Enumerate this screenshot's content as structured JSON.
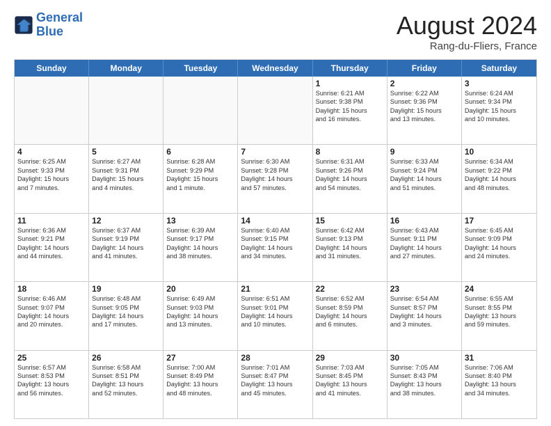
{
  "logo": {
    "text_general": "General",
    "text_blue": "Blue"
  },
  "header": {
    "month_year": "August 2024",
    "location": "Rang-du-Fliers, France"
  },
  "weekdays": [
    "Sunday",
    "Monday",
    "Tuesday",
    "Wednesday",
    "Thursday",
    "Friday",
    "Saturday"
  ],
  "weeks": [
    [
      {
        "day": "",
        "lines": [],
        "empty": true
      },
      {
        "day": "",
        "lines": [],
        "empty": true
      },
      {
        "day": "",
        "lines": [],
        "empty": true
      },
      {
        "day": "",
        "lines": [],
        "empty": true
      },
      {
        "day": "1",
        "lines": [
          "Sunrise: 6:21 AM",
          "Sunset: 9:38 PM",
          "Daylight: 15 hours",
          "and 16 minutes."
        ],
        "empty": false
      },
      {
        "day": "2",
        "lines": [
          "Sunrise: 6:22 AM",
          "Sunset: 9:36 PM",
          "Daylight: 15 hours",
          "and 13 minutes."
        ],
        "empty": false
      },
      {
        "day": "3",
        "lines": [
          "Sunrise: 6:24 AM",
          "Sunset: 9:34 PM",
          "Daylight: 15 hours",
          "and 10 minutes."
        ],
        "empty": false
      }
    ],
    [
      {
        "day": "4",
        "lines": [
          "Sunrise: 6:25 AM",
          "Sunset: 9:33 PM",
          "Daylight: 15 hours",
          "and 7 minutes."
        ],
        "empty": false
      },
      {
        "day": "5",
        "lines": [
          "Sunrise: 6:27 AM",
          "Sunset: 9:31 PM",
          "Daylight: 15 hours",
          "and 4 minutes."
        ],
        "empty": false
      },
      {
        "day": "6",
        "lines": [
          "Sunrise: 6:28 AM",
          "Sunset: 9:29 PM",
          "Daylight: 15 hours",
          "and 1 minute."
        ],
        "empty": false
      },
      {
        "day": "7",
        "lines": [
          "Sunrise: 6:30 AM",
          "Sunset: 9:28 PM",
          "Daylight: 14 hours",
          "and 57 minutes."
        ],
        "empty": false
      },
      {
        "day": "8",
        "lines": [
          "Sunrise: 6:31 AM",
          "Sunset: 9:26 PM",
          "Daylight: 14 hours",
          "and 54 minutes."
        ],
        "empty": false
      },
      {
        "day": "9",
        "lines": [
          "Sunrise: 6:33 AM",
          "Sunset: 9:24 PM",
          "Daylight: 14 hours",
          "and 51 minutes."
        ],
        "empty": false
      },
      {
        "day": "10",
        "lines": [
          "Sunrise: 6:34 AM",
          "Sunset: 9:22 PM",
          "Daylight: 14 hours",
          "and 48 minutes."
        ],
        "empty": false
      }
    ],
    [
      {
        "day": "11",
        "lines": [
          "Sunrise: 6:36 AM",
          "Sunset: 9:21 PM",
          "Daylight: 14 hours",
          "and 44 minutes."
        ],
        "empty": false
      },
      {
        "day": "12",
        "lines": [
          "Sunrise: 6:37 AM",
          "Sunset: 9:19 PM",
          "Daylight: 14 hours",
          "and 41 minutes."
        ],
        "empty": false
      },
      {
        "day": "13",
        "lines": [
          "Sunrise: 6:39 AM",
          "Sunset: 9:17 PM",
          "Daylight: 14 hours",
          "and 38 minutes."
        ],
        "empty": false
      },
      {
        "day": "14",
        "lines": [
          "Sunrise: 6:40 AM",
          "Sunset: 9:15 PM",
          "Daylight: 14 hours",
          "and 34 minutes."
        ],
        "empty": false
      },
      {
        "day": "15",
        "lines": [
          "Sunrise: 6:42 AM",
          "Sunset: 9:13 PM",
          "Daylight: 14 hours",
          "and 31 minutes."
        ],
        "empty": false
      },
      {
        "day": "16",
        "lines": [
          "Sunrise: 6:43 AM",
          "Sunset: 9:11 PM",
          "Daylight: 14 hours",
          "and 27 minutes."
        ],
        "empty": false
      },
      {
        "day": "17",
        "lines": [
          "Sunrise: 6:45 AM",
          "Sunset: 9:09 PM",
          "Daylight: 14 hours",
          "and 24 minutes."
        ],
        "empty": false
      }
    ],
    [
      {
        "day": "18",
        "lines": [
          "Sunrise: 6:46 AM",
          "Sunset: 9:07 PM",
          "Daylight: 14 hours",
          "and 20 minutes."
        ],
        "empty": false
      },
      {
        "day": "19",
        "lines": [
          "Sunrise: 6:48 AM",
          "Sunset: 9:05 PM",
          "Daylight: 14 hours",
          "and 17 minutes."
        ],
        "empty": false
      },
      {
        "day": "20",
        "lines": [
          "Sunrise: 6:49 AM",
          "Sunset: 9:03 PM",
          "Daylight: 14 hours",
          "and 13 minutes."
        ],
        "empty": false
      },
      {
        "day": "21",
        "lines": [
          "Sunrise: 6:51 AM",
          "Sunset: 9:01 PM",
          "Daylight: 14 hours",
          "and 10 minutes."
        ],
        "empty": false
      },
      {
        "day": "22",
        "lines": [
          "Sunrise: 6:52 AM",
          "Sunset: 8:59 PM",
          "Daylight: 14 hours",
          "and 6 minutes."
        ],
        "empty": false
      },
      {
        "day": "23",
        "lines": [
          "Sunrise: 6:54 AM",
          "Sunset: 8:57 PM",
          "Daylight: 14 hours",
          "and 3 minutes."
        ],
        "empty": false
      },
      {
        "day": "24",
        "lines": [
          "Sunrise: 6:55 AM",
          "Sunset: 8:55 PM",
          "Daylight: 13 hours",
          "and 59 minutes."
        ],
        "empty": false
      }
    ],
    [
      {
        "day": "25",
        "lines": [
          "Sunrise: 6:57 AM",
          "Sunset: 8:53 PM",
          "Daylight: 13 hours",
          "and 56 minutes."
        ],
        "empty": false
      },
      {
        "day": "26",
        "lines": [
          "Sunrise: 6:58 AM",
          "Sunset: 8:51 PM",
          "Daylight: 13 hours",
          "and 52 minutes."
        ],
        "empty": false
      },
      {
        "day": "27",
        "lines": [
          "Sunrise: 7:00 AM",
          "Sunset: 8:49 PM",
          "Daylight: 13 hours",
          "and 48 minutes."
        ],
        "empty": false
      },
      {
        "day": "28",
        "lines": [
          "Sunrise: 7:01 AM",
          "Sunset: 8:47 PM",
          "Daylight: 13 hours",
          "and 45 minutes."
        ],
        "empty": false
      },
      {
        "day": "29",
        "lines": [
          "Sunrise: 7:03 AM",
          "Sunset: 8:45 PM",
          "Daylight: 13 hours",
          "and 41 minutes."
        ],
        "empty": false
      },
      {
        "day": "30",
        "lines": [
          "Sunrise: 7:05 AM",
          "Sunset: 8:43 PM",
          "Daylight: 13 hours",
          "and 38 minutes."
        ],
        "empty": false
      },
      {
        "day": "31",
        "lines": [
          "Sunrise: 7:06 AM",
          "Sunset: 8:40 PM",
          "Daylight: 13 hours",
          "and 34 minutes."
        ],
        "empty": false
      }
    ]
  ]
}
